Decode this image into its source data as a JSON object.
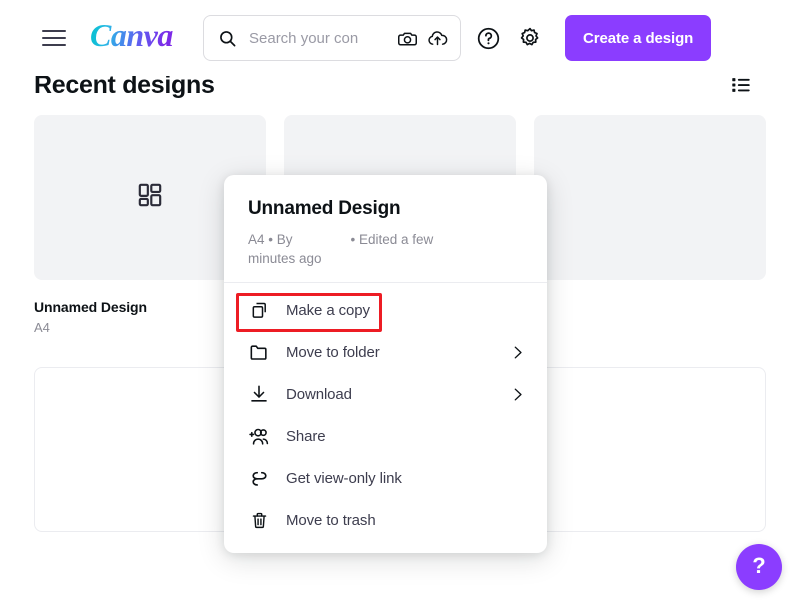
{
  "header": {
    "menu_icon": "hamburger-menu-icon",
    "logo_text": "Canva",
    "search": {
      "placeholder": "Search your con",
      "value": "",
      "search_icon": "search-icon",
      "camera_icon": "camera-icon",
      "upload_icon": "cloud-upload-icon"
    },
    "help_icon": "question-circle-icon",
    "settings_icon": "gear-icon",
    "create_button_label": "Create a design"
  },
  "main": {
    "section_title": "Recent designs",
    "view_toggle_icon": "list-view-icon",
    "cards": [
      {
        "title": "Unnamed Design",
        "subtitle": "A4",
        "thumb_icon": "grid-layout-icon",
        "thumb_style": "filled"
      },
      {
        "title": "",
        "subtitle": "",
        "thumb_icon": "",
        "thumb_style": "grey"
      },
      {
        "title": "",
        "subtitle": "",
        "thumb_icon": "",
        "thumb_style": "grey"
      },
      {
        "title": "",
        "subtitle": "",
        "thumb_icon": "",
        "thumb_style": "outline"
      },
      {
        "title": "",
        "subtitle": "",
        "thumb_icon": "",
        "thumb_style": "outline"
      },
      {
        "title": "",
        "subtitle": "",
        "thumb_icon": "",
        "thumb_style": "outline"
      }
    ]
  },
  "context_menu": {
    "title": "Unnamed Design",
    "meta_left": "A4 • By",
    "meta_right": "• Edited a few",
    "meta_wrap": "minutes ago",
    "items": [
      {
        "label": "Make a copy",
        "icon": "copy-icon",
        "has_submenu": false
      },
      {
        "label": "Move to folder",
        "icon": "folder-icon",
        "has_submenu": true
      },
      {
        "label": "Download",
        "icon": "download-icon",
        "has_submenu": true
      },
      {
        "label": "Share",
        "icon": "add-people-icon",
        "has_submenu": false
      },
      {
        "label": "Get view-only link",
        "icon": "link-icon",
        "has_submenu": false
      },
      {
        "label": "Move to trash",
        "icon": "trash-icon",
        "has_submenu": false
      }
    ]
  },
  "annotation": {
    "target_label": "Make a copy",
    "color": "#ED1C24"
  },
  "help_fab": {
    "label": "?",
    "color": "#8B3DFF"
  },
  "colors": {
    "brand_purple": "#8B3DFF",
    "logo_cyan": "#00C4CC",
    "logo_purple": "#7D2AE8",
    "text_dark": "#0D1216",
    "text_muted": "#8B8B95",
    "card_grey": "#F2F3F5",
    "border_grey": "#EBECF0"
  }
}
